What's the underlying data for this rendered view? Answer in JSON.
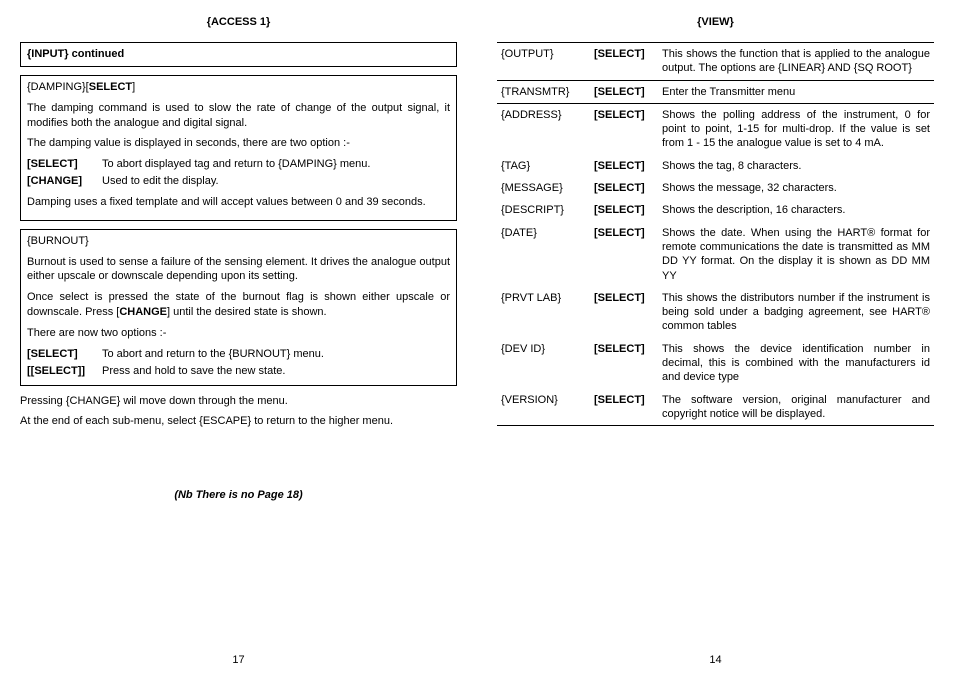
{
  "left": {
    "header": "{ACCESS  1}",
    "input_heading": "{INPUT}    continued",
    "damping": {
      "title": "{DAMPING}[SELECT]",
      "p1": "The damping command is used to slow the rate of change of the output signal, it modifies both the analogue and digital signal.",
      "p2": "The damping value is displayed in seconds, there are two option :-",
      "opt1_key": "[SELECT]",
      "opt1_val": "To abort displayed tag and return to {DAMPING} menu.",
      "opt2_key": "[CHANGE]",
      "opt2_val": "Used to edit the display.",
      "p3": "Damping uses a fixed template and will accept values between 0 and 39 seconds."
    },
    "burnout": {
      "title": "{BURNOUT}",
      "p1": "Burnout is used to sense a failure of the sensing element. It drives the analogue output either upscale or downscale depending upon its setting.",
      "p2": "Once select is pressed the state of the burnout flag is shown either upscale or downscale. Press [CHANGE] until the desired state is shown.",
      "p3": "There are now two options :-",
      "opt1_key": "[SELECT]",
      "opt1_val": "To abort and return to the {BURNOUT} menu.",
      "opt2_key": "[[SELECT]]",
      "opt2_val": "Press and hold to save the new state."
    },
    "f1": "Pressing {CHANGE} wil move down through the menu.",
    "f2": "At the end of each sub-menu, select {ESCAPE} to return to the higher menu.",
    "nb": "(Nb There is no Page 18)",
    "page": "17"
  },
  "right": {
    "header": "{VIEW}",
    "rows": [
      {
        "c1": "{OUTPUT}",
        "c2": "[SELECT]",
        "c3": "This shows the function that is applied to the analogue output. The options are {LINEAR} AND {SQ ROOT}"
      },
      {
        "c1": "{TRANSMTR}",
        "c2": "[SELECT]",
        "c3": "Enter the Transmitter menu"
      },
      {
        "c1": "{ADDRESS}",
        "c2": "[SELECT]",
        "c3": "Shows the polling address of the instrument,  0 for point to point, 1-15 for multi-drop. If the value is set from 1 - 15 the analogue value is set to 4 mA."
      },
      {
        "c1": "{TAG}",
        "c2": "[SELECT]",
        "c3": "Shows the tag, 8 characters."
      },
      {
        "c1": "{MESSAGE}",
        "c2": "[SELECT]",
        "c3": "Shows the message, 32 characters."
      },
      {
        "c1": "{DESCRIPT}",
        "c2": "[SELECT]",
        "c3": "Shows the description, 16 characters."
      },
      {
        "c1": "{DATE}",
        "c2": "[SELECT]",
        "c3": "Shows the date. When using the HART® format for remote communications the date is transmitted as MM DD YY format. On the display it is shown as DD MM YY"
      },
      {
        "c1": "{PRVT LAB}",
        "c2": "[SELECT]",
        "c3": "This shows the distributors number if the instrument is being  sold under a  badging agreement, see HART® common tables"
      },
      {
        "c1": "{DEV  ID}",
        "c2": "[SELECT]",
        "c3": "This shows the device identification number in decimal, this is combined with the manufacturers id and device type"
      },
      {
        "c1": "{VERSION}",
        "c2": "[SELECT]",
        "c3": "The software version, original manufacturer and copyright notice will   be displayed."
      }
    ],
    "page": "14"
  }
}
